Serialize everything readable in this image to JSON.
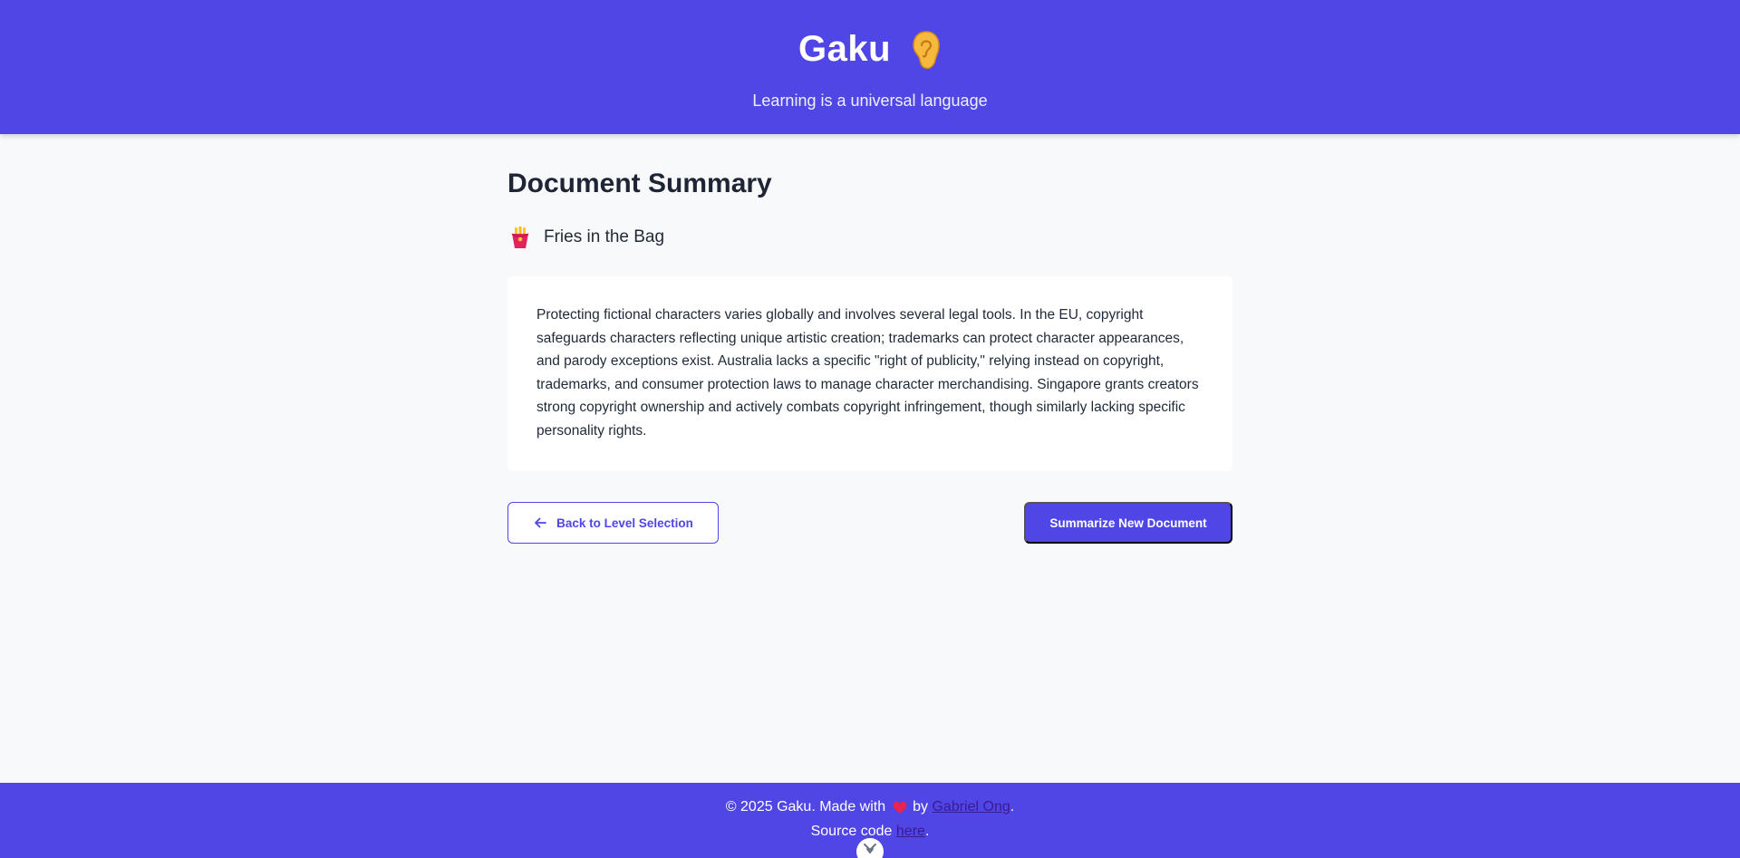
{
  "header": {
    "title": "Gaku",
    "subtitle": "Learning is a universal language",
    "icon": "ear-icon"
  },
  "main": {
    "heading": "Document Summary",
    "level": {
      "icon": "fries-icon",
      "label": "Fries in the Bag"
    },
    "summary": "Protecting fictional characters varies globally and involves several legal tools. In the EU, copyright safeguards characters reflecting unique artistic creation; trademarks can protect character appearances, and parody exceptions exist. Australia lacks a specific \"right of publicity,\" relying instead on copyright, trademarks, and consumer protection laws to manage character merchandising. Singapore grants creators strong copyright ownership and actively combats copyright infringement, though similarly lacking specific personality rights."
  },
  "actions": {
    "back_label": "Back to Level Selection",
    "new_label": "Summarize New Document"
  },
  "footer": {
    "copyright_prefix": "© 2025 Gaku. Made with",
    "by": "by",
    "author": "Gabriel Ong",
    "period": ".",
    "source_prefix": "Source code",
    "source_link": "here",
    "source_suffix": "."
  },
  "colors": {
    "brand": "#4f46e5",
    "background": "#f8f9fb",
    "card": "#ffffff"
  }
}
